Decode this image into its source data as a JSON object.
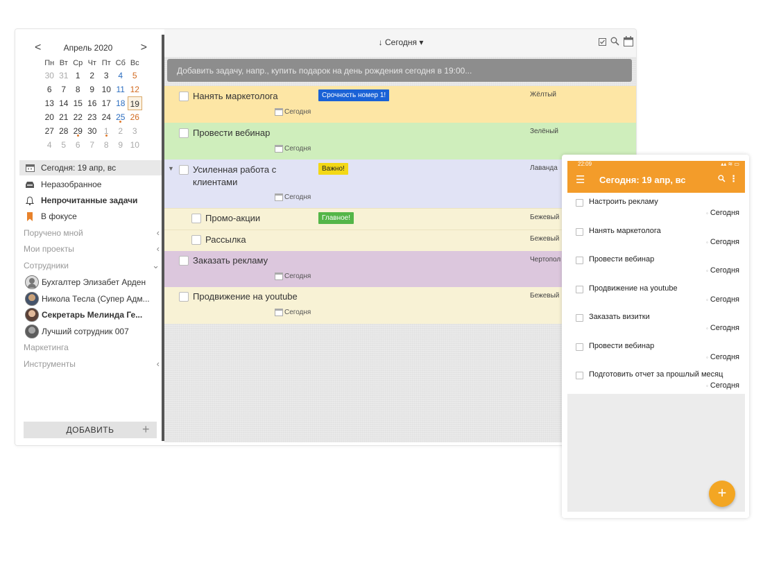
{
  "calendar": {
    "prev_arrow": "<",
    "next_arrow": ">",
    "month_title": "Апрель 2020",
    "weekdays": [
      "Пн",
      "Вт",
      "Ср",
      "Чт",
      "Пт",
      "Сб",
      "Вс"
    ],
    "weeks": [
      [
        "30",
        "31",
        "1",
        "2",
        "3",
        "4",
        "5"
      ],
      [
        "6",
        "7",
        "8",
        "9",
        "10",
        "11",
        "12"
      ],
      [
        "13",
        "14",
        "15",
        "16",
        "17",
        "18",
        "19"
      ],
      [
        "20",
        "21",
        "22",
        "23",
        "24",
        "25",
        "26"
      ],
      [
        "27",
        "28",
        "29",
        "30",
        "1",
        "2",
        "3"
      ],
      [
        "4",
        "5",
        "6",
        "7",
        "8",
        "9",
        "10"
      ]
    ],
    "selected_day": "19"
  },
  "sidebar": {
    "items": [
      {
        "label": "Сегодня: 19 апр, вс",
        "icon": "calendar-icon"
      },
      {
        "label": "Неразобранное",
        "icon": "inbox-icon"
      },
      {
        "label": "Непрочитанные задачи",
        "icon": "bell-icon"
      },
      {
        "label": "В фокусе",
        "icon": "bookmark-icon"
      }
    ],
    "groups": {
      "assigned": "Поручено мной",
      "projects": "Мои проекты",
      "employees": "Сотрудники",
      "marketing": "Маркетинга",
      "tools": "Инструменты"
    },
    "employees": [
      {
        "name": "Бухгалтер Элизабет Арден"
      },
      {
        "name": "Никола Тесла (Супер Адм..."
      },
      {
        "name": "Секретарь Мелинда Ге..."
      },
      {
        "name": "Лучший сотрудник 007"
      }
    ],
    "add_label": "ДОБАВИТЬ",
    "add_plus": "+"
  },
  "toolbar": {
    "sort_label": "↓ Сегодня ▾"
  },
  "add_task": {
    "placeholder": "Добавить задачу, напр., купить подарок на день рождения сегодня в 19:00..."
  },
  "tasks": [
    {
      "title": "Нанять маркетолога",
      "tag": "Срочность номер 1!",
      "tag_color": "#1a62d6",
      "color_name": "Жёлтый",
      "bg": "#fde6a5",
      "due": "Сегодня"
    },
    {
      "title": "Провести вебинар",
      "tag": "",
      "color_name": "Зелёный",
      "bg": "#cfeebc",
      "due": "Сегодня"
    },
    {
      "title": "Усиленная работа с",
      "title2": "клиентами",
      "tag": "Важно!",
      "tag_color": "#f3d816",
      "color_name": "Лаванда",
      "bg": "#e1e3f5",
      "due": "Сегодня"
    },
    {
      "title": "Промо-акции",
      "tag": "Главное!",
      "tag_color": "#54b648",
      "color_name": "Бежевый",
      "bg": "#f8f2d5"
    },
    {
      "title": "Рассылка",
      "tag": "",
      "color_name": "Бежевый",
      "bg": "#f8f2d5"
    },
    {
      "title": "Заказать рекламу",
      "tag": "",
      "color_name": "Чертопол",
      "bg": "#dcc7dd",
      "due": "Сегодня"
    },
    {
      "title": "Продвижение на youtube",
      "tag": "",
      "color_name": "Бежевый",
      "bg": "#f8f2d5",
      "due": "Сегодня"
    }
  ],
  "mobile": {
    "time": "22:09",
    "indicators": "▴▴ ≋ ▭",
    "title": "Сегодня: 19 апр, вс",
    "menu_glyph": "☰",
    "search_glyph": "🔍",
    "more_glyph": "⋮",
    "fab": "+",
    "items": [
      {
        "title": "Настроить рекламу",
        "due": "Сегодня"
      },
      {
        "title": "Нанять маркетолога",
        "due": "Сегодня"
      },
      {
        "title": "Провести вебинар",
        "due": "Сегодня"
      },
      {
        "title": "Продвижение на youtube",
        "due": "Сегодня"
      },
      {
        "title": "Заказать визитки",
        "due": "Сегодня"
      },
      {
        "title": "Провести вебинар",
        "due": "Сегодня"
      },
      {
        "title": "Подготовить отчет за прошлый месяц",
        "due": "Сегодня"
      }
    ]
  },
  "colors": {
    "accent": "#f39c2a",
    "saturday": "#2b6dbf",
    "sunday": "#d2691e"
  }
}
